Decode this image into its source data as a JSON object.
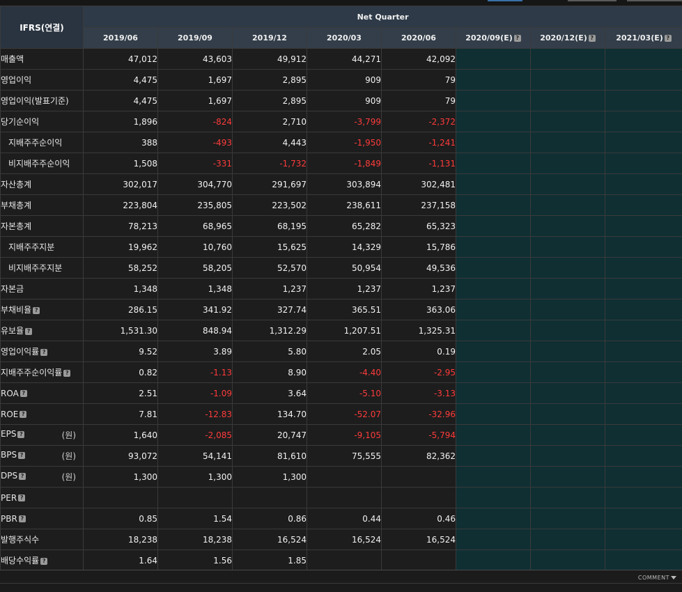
{
  "header": {
    "ifrs_label": "IFRS(연결)",
    "group_label": "Net Quarter",
    "periods": [
      "2019/06",
      "2019/09",
      "2019/12",
      "2020/03",
      "2020/06",
      "2020/09(E)",
      "2020/12(E)",
      "2021/03(E)"
    ],
    "estimate_help_icon": "help-icon"
  },
  "rows": [
    {
      "label": "매출액",
      "indent": false,
      "help": false,
      "unit": "",
      "values": [
        "47,012",
        "43,603",
        "49,912",
        "44,271",
        "42,092"
      ]
    },
    {
      "label": "영업이익",
      "indent": false,
      "help": false,
      "unit": "",
      "values": [
        "4,475",
        "1,697",
        "2,895",
        "909",
        "79"
      ]
    },
    {
      "label": "영업이익(발표기준)",
      "indent": false,
      "help": false,
      "unit": "",
      "values": [
        "4,475",
        "1,697",
        "2,895",
        "909",
        "79"
      ]
    },
    {
      "label": "당기순이익",
      "indent": false,
      "help": false,
      "unit": "",
      "values": [
        "1,896",
        "-824",
        "2,710",
        "-3,799",
        "-2,372"
      ]
    },
    {
      "label": "지배주주순이익",
      "indent": true,
      "help": false,
      "unit": "",
      "values": [
        "388",
        "-493",
        "4,443",
        "-1,950",
        "-1,241"
      ]
    },
    {
      "label": "비지배주주순이익",
      "indent": true,
      "help": false,
      "unit": "",
      "values": [
        "1,508",
        "-331",
        "-1,732",
        "-1,849",
        "-1,131"
      ]
    },
    {
      "label": "자산총계",
      "indent": false,
      "help": false,
      "unit": "",
      "values": [
        "302,017",
        "304,770",
        "291,697",
        "303,894",
        "302,481"
      ]
    },
    {
      "label": "부채총계",
      "indent": false,
      "help": false,
      "unit": "",
      "values": [
        "223,804",
        "235,805",
        "223,502",
        "238,611",
        "237,158"
      ]
    },
    {
      "label": "자본총계",
      "indent": false,
      "help": false,
      "unit": "",
      "values": [
        "78,213",
        "68,965",
        "68,195",
        "65,282",
        "65,323"
      ]
    },
    {
      "label": "지배주주지분",
      "indent": true,
      "help": false,
      "unit": "",
      "values": [
        "19,962",
        "10,760",
        "15,625",
        "14,329",
        "15,786"
      ]
    },
    {
      "label": "비지배주주지분",
      "indent": true,
      "help": false,
      "unit": "",
      "values": [
        "58,252",
        "58,205",
        "52,570",
        "50,954",
        "49,536"
      ]
    },
    {
      "label": "자본금",
      "indent": false,
      "help": false,
      "unit": "",
      "values": [
        "1,348",
        "1,348",
        "1,237",
        "1,237",
        "1,237"
      ]
    },
    {
      "label": "부채비율",
      "indent": false,
      "help": true,
      "unit": "",
      "values": [
        "286.15",
        "341.92",
        "327.74",
        "365.51",
        "363.06"
      ]
    },
    {
      "label": "유보율",
      "indent": false,
      "help": true,
      "unit": "",
      "values": [
        "1,531.30",
        "848.94",
        "1,312.29",
        "1,207.51",
        "1,325.31"
      ]
    },
    {
      "label": "영업이익률",
      "indent": false,
      "help": true,
      "unit": "",
      "values": [
        "9.52",
        "3.89",
        "5.80",
        "2.05",
        "0.19"
      ]
    },
    {
      "label": "지배주주순이익률",
      "indent": false,
      "help": true,
      "unit": "",
      "values": [
        "0.82",
        "-1.13",
        "8.90",
        "-4.40",
        "-2.95"
      ]
    },
    {
      "label": "ROA",
      "indent": false,
      "help": true,
      "unit": "",
      "values": [
        "2.51",
        "-1.09",
        "3.64",
        "-5.10",
        "-3.13"
      ]
    },
    {
      "label": "ROE",
      "indent": false,
      "help": true,
      "unit": "",
      "values": [
        "7.81",
        "-12.83",
        "134.70",
        "-52.07",
        "-32.96"
      ]
    },
    {
      "label": "EPS",
      "indent": false,
      "help": true,
      "unit": "(원)",
      "values": [
        "1,640",
        "-2,085",
        "20,747",
        "-9,105",
        "-5,794"
      ]
    },
    {
      "label": "BPS",
      "indent": false,
      "help": true,
      "unit": "(원)",
      "values": [
        "93,072",
        "54,141",
        "81,610",
        "75,555",
        "82,362"
      ]
    },
    {
      "label": "DPS",
      "indent": false,
      "help": true,
      "unit": "(원)",
      "values": [
        "1,300",
        "1,300",
        "1,300",
        "",
        ""
      ]
    },
    {
      "label": "PER",
      "indent": false,
      "help": true,
      "unit": "",
      "values": [
        "",
        "",
        "",
        "",
        ""
      ]
    },
    {
      "label": "PBR",
      "indent": false,
      "help": true,
      "unit": "",
      "values": [
        "0.85",
        "1.54",
        "0.86",
        "0.44",
        "0.46"
      ]
    },
    {
      "label": "발행주식수",
      "indent": false,
      "help": false,
      "unit": "",
      "values": [
        "18,238",
        "18,238",
        "16,524",
        "16,524",
        "16,524"
      ]
    },
    {
      "label": "배당수익률",
      "indent": false,
      "help": true,
      "unit": "",
      "values": [
        "1.64",
        "1.56",
        "1.85",
        "",
        ""
      ]
    }
  ],
  "footer": {
    "comment_label": "COMMENT"
  },
  "colors": {
    "negative": "#ff3b3b",
    "estimate_bg": "#0f2f33",
    "header_bg": "#2a3440"
  }
}
